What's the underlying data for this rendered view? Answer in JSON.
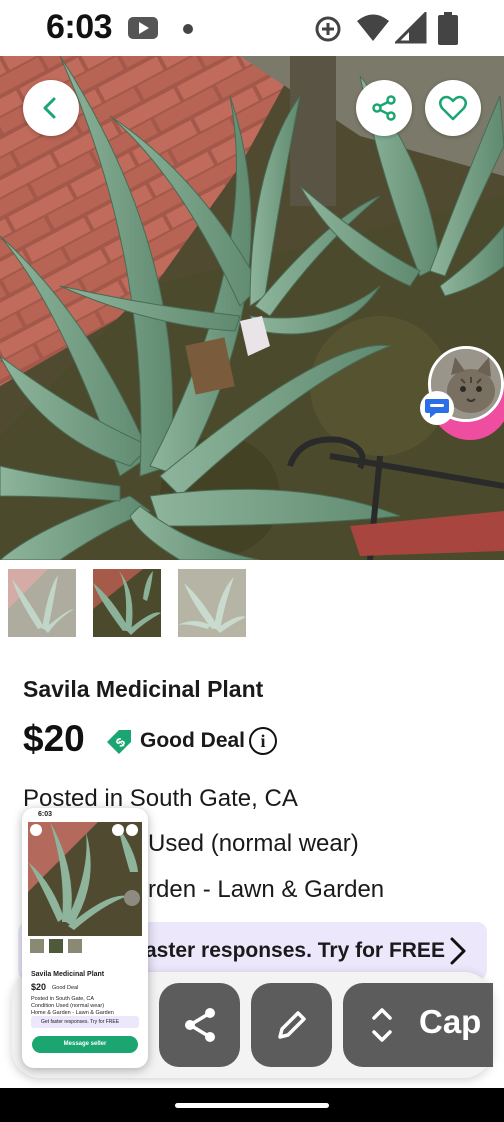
{
  "status_bar": {
    "time": "6:03",
    "icons": [
      "youtube-icon",
      "notification-dot-icon",
      "data-saver-icon",
      "wifi-icon",
      "cell-signal-icon",
      "battery-icon"
    ]
  },
  "hero": {
    "back_icon": "chevron-left-icon",
    "share_icon": "share-icon",
    "favorite_icon": "heart-icon",
    "chat_icon": "chat-bubble-icon"
  },
  "thumbnails": [
    {
      "name": "photo-1"
    },
    {
      "name": "photo-2",
      "selected": true
    },
    {
      "name": "photo-3"
    }
  ],
  "listing": {
    "title": "Savila Medicinal Plant",
    "price": "$20",
    "deal_label": "Good Deal",
    "posted": "Posted in South Gate, CA",
    "condition_partial": "Used (normal wear)",
    "category_partial": "rden - Lawn & Garden",
    "promo_partial": "aster responses.  Try for FREE"
  },
  "screenshot_toolbar": {
    "share_icon": "share-icon",
    "edit_icon": "pencil-icon",
    "expand_icon": "expand-vertical-icon",
    "capture_label": "Cap"
  },
  "preview": {
    "time": "6:03",
    "title": "Savila Medicinal Plant",
    "price": "$20",
    "deal": "Good Deal",
    "line1": "Posted in South Gate, CA",
    "line2": "Condition Used (normal wear)",
    "line3": "Home & Garden - Lawn & Garden",
    "promo": "Get faster responses. Try for FREE",
    "button": "Message seller"
  },
  "colors": {
    "accent_green": "#1aa571",
    "promo_bg": "#ece7fb",
    "avatar_ring": "#ee4da0",
    "chat_blue": "#2a6ee8"
  }
}
